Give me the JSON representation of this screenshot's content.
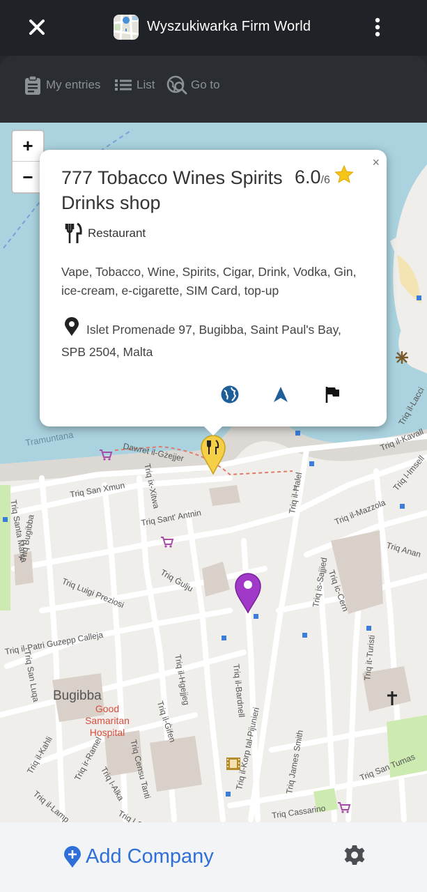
{
  "appbar": {
    "title": "Wyszukiwarka Firm World",
    "close_icon": "close-icon",
    "menu_icon": "more-vert-icon"
  },
  "toolbar": {
    "my_entries": "My entries",
    "list": "List",
    "go_to": "Go to"
  },
  "map": {
    "zoom_in": "+",
    "zoom_out": "−",
    "town": "Bugibba",
    "hospital": "Good Samaritan Hospital",
    "coastal": "Tramuntana",
    "streets": [
      "Dawret il-Gżejjer",
      "Triq San Xmun",
      "Triq Santa Marija",
      "Triq ix-Xitwa",
      "Triq Sant' Antnin",
      "Triq Luigi Preziosi",
      "Triq Ġulju",
      "Triq il-Patri Guzepp Calleja",
      "Triq Bugibba",
      "Triq San Luqa",
      "Triq il-Ħalel",
      "Triq il-Mazzola",
      "Triq is-Sajjied",
      "Triq ic-Cern",
      "Triq it-Turisti",
      "Triq il-Bardnell",
      "Triq il-Korp tal-Pijunieri",
      "Triq il-Ġifen",
      "Triq il-Hgejjeg",
      "Triq Censu Tanti",
      "Triq ir-Ramel",
      "Triq l-Alka",
      "Triq James Smith",
      "Triq San Tumas",
      "Triq Cassarino",
      "Triq Anan",
      "Triq il-Kavall",
      "Triq l-Imsell",
      "Triq il-Lacci",
      "Triq il-Kahli",
      "Triq il-Lamp",
      "Triq l-Ghaq"
    ]
  },
  "popup": {
    "close": "×",
    "name": "777 Tobacco Wines Spirits Drinks shop",
    "rating": "6.0",
    "rating_of": "/6",
    "category": "Restaurant",
    "description": "Vape, Tobacco, Wine, Spirits, Cigar, Drink, Vodka, Gin, ice-cream, e-cigarette, SIM Card, top-up",
    "address": "Islet Promenade 97, Bugibba, Saint Paul's Bay, SPB 2504, Malta",
    "colors": {
      "star": "#f5c518",
      "action": "#1f5f99",
      "flag": "#111111"
    }
  },
  "bottombar": {
    "add_company": "Add Company",
    "accent": "#2f6fd8"
  }
}
